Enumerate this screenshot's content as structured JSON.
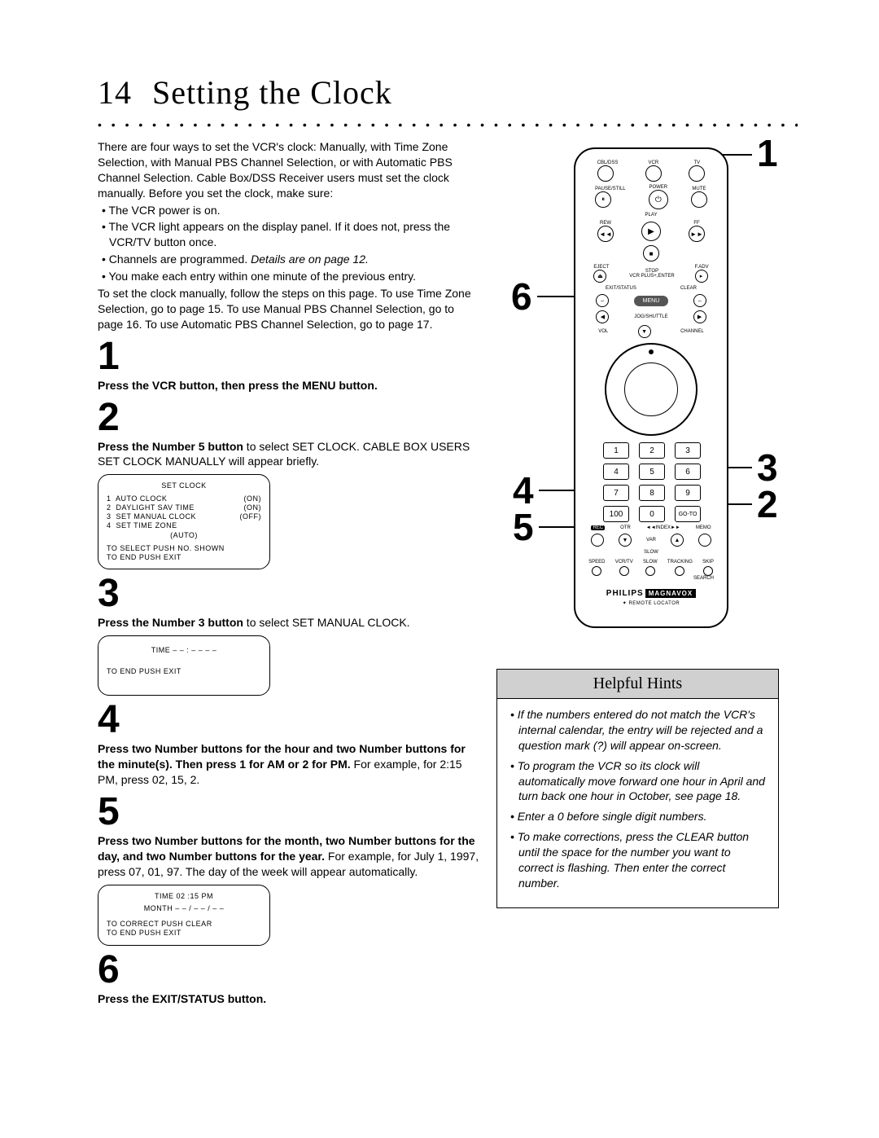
{
  "page": {
    "number": "14",
    "title": "Setting the Clock"
  },
  "intro": {
    "p1": "There are four ways to set the VCR's clock: Manually, with Time Zone Selection, with Manual PBS Channel Selection, or with Automatic PBS Channel Selection. Cable Box/DSS Receiver users must set the clock manually. Before you set the clock, make sure:",
    "b1": "The VCR power is on.",
    "b2": "The VCR light appears on the display panel. If it does not, press the VCR/TV button once.",
    "b3_a": "Channels are programmed. ",
    "b3_b": "Details are on page 12.",
    "b4": "You make each entry within one minute of the previous entry.",
    "p2": "To set the clock manually, follow the steps on this page. To use Time Zone Selection, go to page 15. To use Manual PBS Channel Selection, go to page 16. To use Automatic PBS Channel Selection, go to page 17."
  },
  "steps": {
    "s1": {
      "num": "1",
      "text": "Press the VCR button, then press the MENU button."
    },
    "s2": {
      "num": "2",
      "bold": "Press the Number 5 button",
      "rest": " to select SET CLOCK. CABLE BOX USERS SET CLOCK MANUALLY will appear briefly."
    },
    "s3": {
      "num": "3",
      "bold": "Press the Number 3 button",
      "rest": " to select SET MANUAL CLOCK."
    },
    "s4": {
      "num": "4",
      "bold": "Press two Number buttons for the hour and two Number buttons for the minute(s). Then press 1 for AM or 2 for PM.",
      "rest": " For example, for 2:15 PM, press 02, 15, 2."
    },
    "s5": {
      "num": "5",
      "bold": "Press two Number buttons for the month, two Number buttons for the day, and two Number buttons for the year.",
      "rest": " For example, for July 1, 1997, press 07, 01, 97. The day of the week will appear automatically."
    },
    "s6": {
      "num": "6",
      "text": "Press the EXIT/STATUS button."
    }
  },
  "osd1": {
    "title": "SET CLOCK",
    "l1a": "1  AUTO CLOCK",
    "l1b": "(ON)",
    "l2a": "2  DAYLIGHT SAV TIME",
    "l2b": "(ON)",
    "l3a": "3  SET MANUAL CLOCK",
    "l3b": "(OFF)",
    "l4a": "4  SET TIME ZONE",
    "l4b": "",
    "l5": "(AUTO)",
    "f1": "TO SELECT PUSH NO. SHOWN",
    "f2": "TO END PUSH EXIT"
  },
  "osd2": {
    "l1": "TIME   – – : – –   – –",
    "f1": "TO END PUSH EXIT"
  },
  "osd3": {
    "l1": "TIME  02 :15 PM",
    "l2": "MONTH   – – / – – / – –",
    "f1": "TO CORRECT PUSH CLEAR",
    "f2": "TO END PUSH EXIT"
  },
  "callouts": {
    "c1": "1",
    "c6": "6",
    "c3": "3",
    "c2": "2",
    "c4": "4",
    "c5": "5"
  },
  "remote": {
    "top": {
      "a": "CBL/DSS",
      "b": "VCR",
      "c": "TV"
    },
    "row2": {
      "a": "PAUSE/STILL",
      "b": "POWER",
      "c": "MUTE"
    },
    "play": "PLAY",
    "rew": "REW",
    "ff": "FF",
    "eject": "EJECT",
    "stop": "STOP",
    "fadv": "F.ADV",
    "vcrplus": "VCR PLUS+,ENTER",
    "exit": "EXIT/STATUS",
    "clear": "CLEAR",
    "menu": "MENU",
    "jog": "JOG/SHUTTLE",
    "vol": "VOL",
    "chan": "CHANNEL",
    "keys": [
      "1",
      "2",
      "3",
      "4",
      "5",
      "6",
      "7",
      "8",
      "9",
      "100",
      "0",
      "GO-TO"
    ],
    "recrow": {
      "rec": "REC",
      "otr": "OTR",
      "index": "◄◄INDEX►►",
      "memo": "MEMO"
    },
    "var": "VAR",
    "slow": "SLOW",
    "bottom": [
      "SPEED",
      "VCR/TV",
      "SLOW",
      "TRACKING",
      "SKIP"
    ],
    "search": "SEARCH",
    "brand": "PHILIPS",
    "brand2": "MAGNAVOX",
    "locator": "✦ REMOTE LOCATOR"
  },
  "hints": {
    "title": "Helpful Hints",
    "h1": "If the numbers entered do not match the VCR's internal calendar, the entry will be rejected and a question mark (?) will appear on-screen.",
    "h2": "To program the VCR so its clock will automatically move forward one hour in April and turn back one hour in October, see page 18.",
    "h3": "Enter a 0 before single digit numbers.",
    "h4": "To make corrections, press the CLEAR button until the space for the number you want to correct is flashing. Then enter the correct number."
  }
}
